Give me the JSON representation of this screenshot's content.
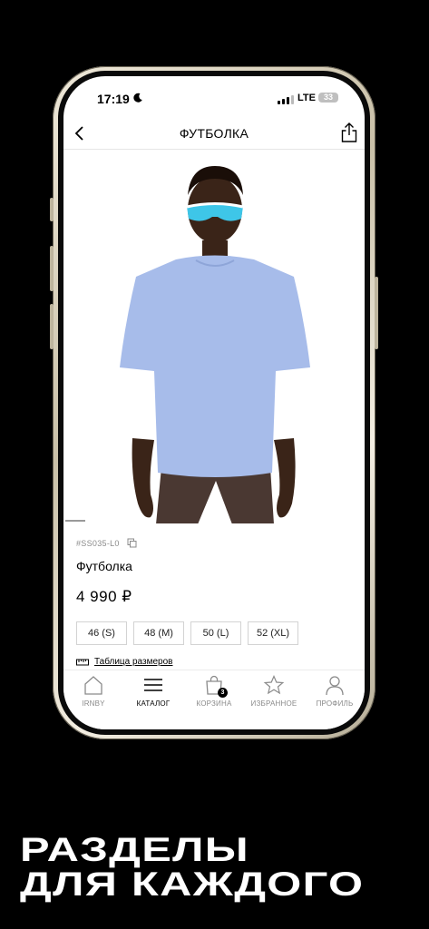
{
  "status_bar": {
    "time": "17:19",
    "network": "LTE",
    "battery": "33"
  },
  "nav": {
    "title": "ФУТБОЛКА"
  },
  "product": {
    "sku": "#SS035-L0",
    "name": "Футболка",
    "price": "4 990 ₽",
    "sizes": [
      "46 (S)",
      "48 (M)",
      "50 (L)",
      "52 (XL)"
    ],
    "size_table_label": "Таблица размеров",
    "image_slide": {
      "current": 1
    }
  },
  "tabs": [
    {
      "label": "IRNBY",
      "icon": "home-icon",
      "active": false
    },
    {
      "label": "КАТАЛОГ",
      "icon": "menu-icon",
      "active": true
    },
    {
      "label": "КОРЗИНА",
      "icon": "bag-icon",
      "active": false,
      "badge": "3"
    },
    {
      "label": "ИЗБРАННОЕ",
      "icon": "star-icon",
      "active": false
    },
    {
      "label": "ПРОФИЛЬ",
      "icon": "profile-icon",
      "active": false
    }
  ],
  "promo": {
    "line1": "РАЗДЕЛЫ",
    "line2": "ДЛЯ КАЖДОГО"
  },
  "colors": {
    "background": "#000000",
    "shirt": "#a7bcea",
    "shorts": "#4a3832",
    "skin": "#3a2418"
  }
}
